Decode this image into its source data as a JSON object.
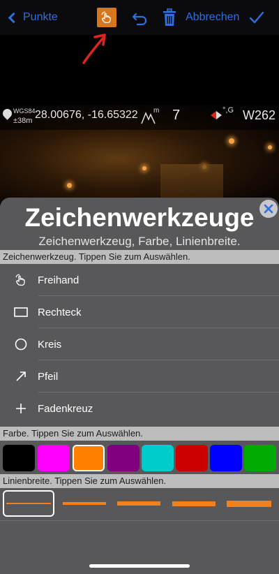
{
  "navbar": {
    "back_label": "Punkte",
    "cancel_label": "Abbrechen",
    "accent_color": "#2f6fe0",
    "draw_button_color": "#d8761e",
    "icons": [
      "chevron-left-icon",
      "hand-draw-icon",
      "undo-icon",
      "trash-icon",
      "checkmark-icon"
    ]
  },
  "gps": {
    "datum": "WGS84",
    "accuracy": "±38m",
    "coordinates": "28.00676, -16.65322",
    "altitude_unit": "m",
    "count": "7",
    "compass_unit": "°,G",
    "heading": "W262"
  },
  "sheet": {
    "title": "Zeichenwerkzeuge",
    "subtitle": "Zeichenwerkzeug, Farbe, Linienbreite."
  },
  "sections": {
    "tools_header": "Zeichenwerkzeug. Tippen Sie zum Auswählen.",
    "color_header": "Farbe. Tippen Sie zum Auswählen.",
    "width_header": "Linienbreite. Tippen Sie zum Auswählen."
  },
  "tools": [
    {
      "label": "Freihand",
      "icon": "hand-draw-icon"
    },
    {
      "label": "Rechteck",
      "icon": "rectangle-icon"
    },
    {
      "label": "Kreis",
      "icon": "circle-icon"
    },
    {
      "label": "Pfeil",
      "icon": "arrow-icon"
    },
    {
      "label": "Fadenkreuz",
      "icon": "crosshair-icon"
    }
  ],
  "colors": {
    "options": [
      "#000000",
      "#ff00ff",
      "#ff8000",
      "#800080",
      "#00cccc",
      "#cc0000",
      "#0000ff",
      "#00aa00"
    ],
    "selected_index": 2
  },
  "line_widths": {
    "count": 5,
    "selected_index": 0,
    "line_color": "#f4801c"
  }
}
